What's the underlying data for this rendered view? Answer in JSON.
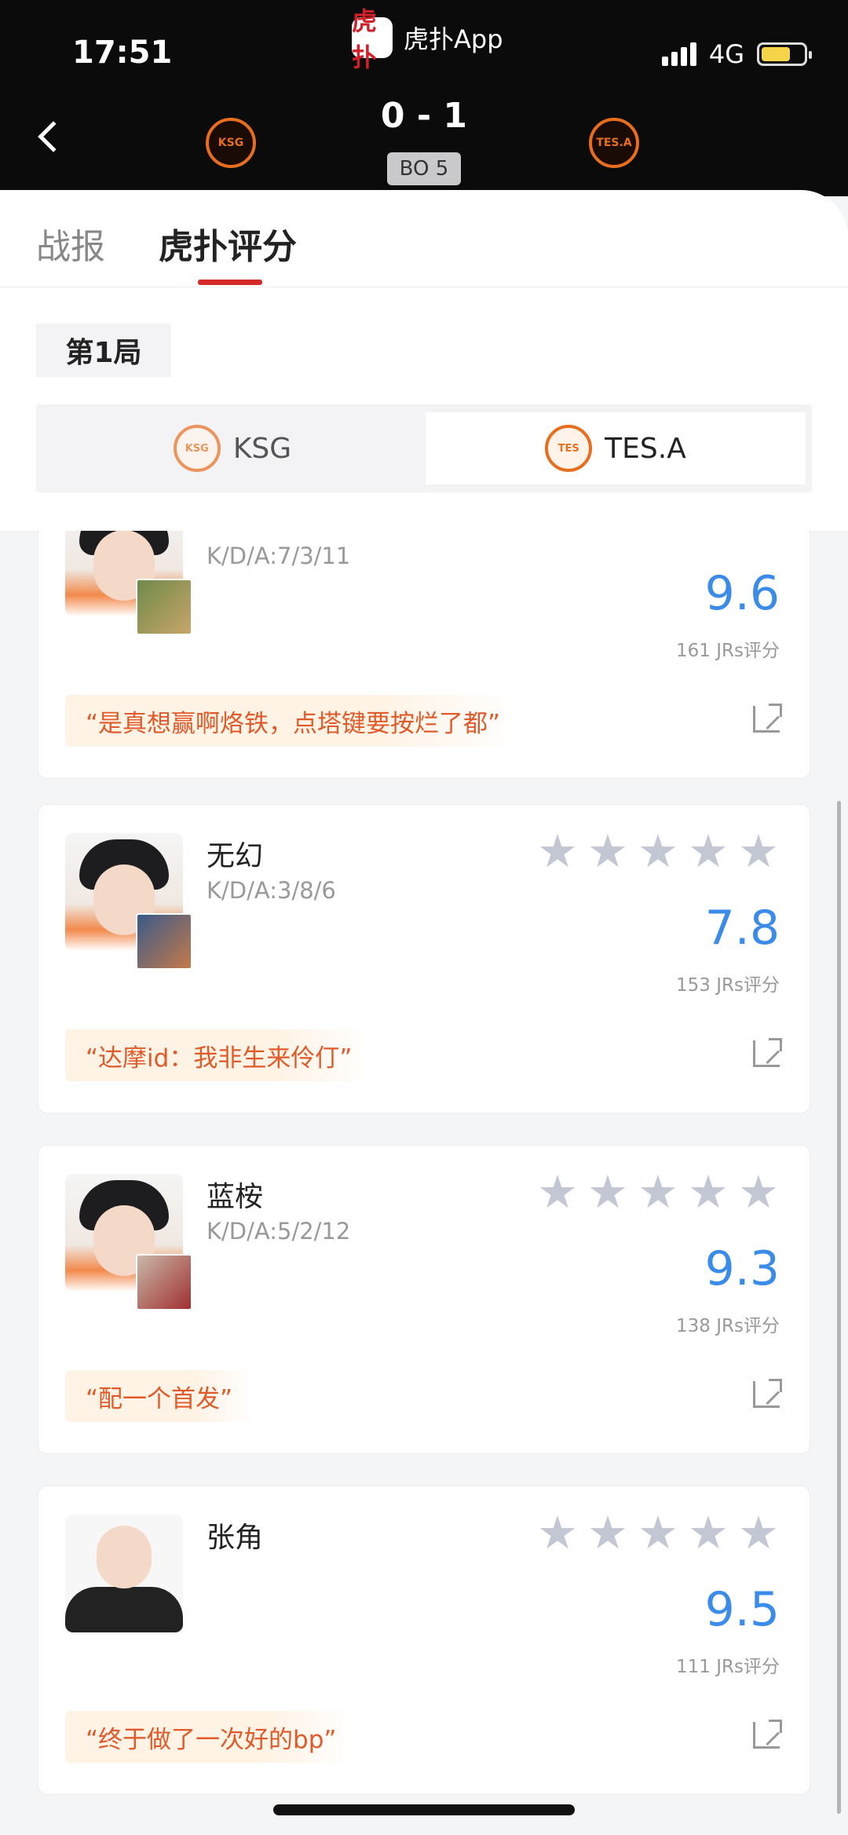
{
  "status_bar": {
    "time": "17:51",
    "network": "4G",
    "app_name": "虎扑App",
    "app_logo_text": "虎扑"
  },
  "match": {
    "score": "0 - 1",
    "format": "BO 5",
    "home_team_logo": "KSG",
    "away_team_logo": "TES.A"
  },
  "tabs": [
    {
      "label": "战报",
      "active": false
    },
    {
      "label": "虎扑评分",
      "active": true
    }
  ],
  "game_label": "第1局",
  "team_switch": {
    "left": "KSG",
    "right": "TES.A",
    "selected": "TES.A"
  },
  "players": [
    {
      "name": "",
      "kda": "K/D/A:7/3/11",
      "score": "9.6",
      "votes": "161 JRs评分",
      "quote": "“是真想赢啊烙铁，点塔键要按烂了都”"
    },
    {
      "name": "无幻",
      "kda": "K/D/A:3/8/6",
      "score": "7.8",
      "votes": "153 JRs评分",
      "quote": "“达摩id：我非生来伶仃”"
    },
    {
      "name": "蓝桉",
      "kda": "K/D/A:5/2/12",
      "score": "9.3",
      "votes": "138 JRs评分",
      "quote": "“配一个首发”"
    },
    {
      "name": "张角",
      "kda": "",
      "score": "9.5",
      "votes": "111 JRs评分",
      "quote": "“终于做了一次好的bp”"
    }
  ],
  "colors": {
    "accent_red": "#d42a2a",
    "score_blue": "#3b8ce8",
    "quote_orange": "#e05a2a",
    "team_orange": "#e86e1e"
  }
}
